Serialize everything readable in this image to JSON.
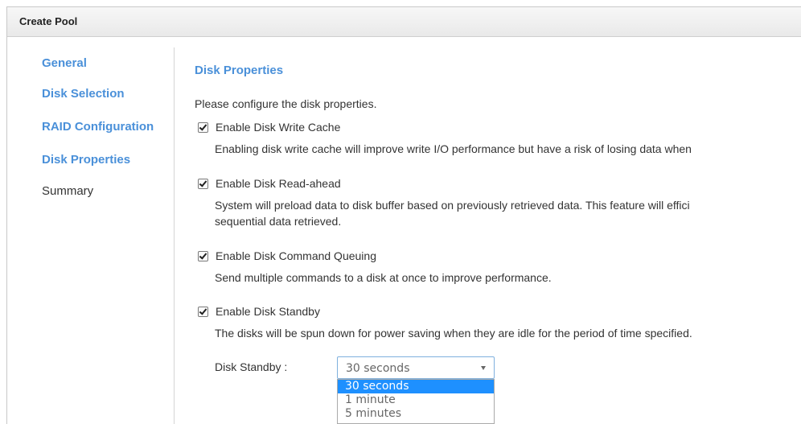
{
  "dialog": {
    "title": "Create Pool"
  },
  "sidebar": {
    "items": [
      {
        "label": "General"
      },
      {
        "label": "Disk Selection"
      },
      {
        "label": "RAID Configuration"
      },
      {
        "label": "Disk Properties"
      },
      {
        "label": "Summary"
      }
    ]
  },
  "content": {
    "section_title": "Disk Properties",
    "intro": "Please configure the disk properties.",
    "options": [
      {
        "label": "Enable Disk Write Cache",
        "checked": true,
        "description": "Enabling disk write cache will improve write I/O performance but have a risk of losing data when"
      },
      {
        "label": "Enable Disk Read-ahead",
        "checked": true,
        "description": "System will preload data to disk buffer based on previously retrieved data. This feature will effici",
        "description_line2": "sequential data retrieved."
      },
      {
        "label": "Enable Disk Command Queuing",
        "checked": true,
        "description": "Send multiple commands to a disk at once to improve performance."
      },
      {
        "label": "Enable Disk Standby",
        "checked": true,
        "description": "The disks will be spun down for power saving when they are idle for the period of time specified."
      }
    ],
    "standby": {
      "label": "Disk Standby :",
      "selected": "30 seconds",
      "options": [
        "30 seconds",
        "1 minute",
        "5 minutes"
      ]
    }
  }
}
